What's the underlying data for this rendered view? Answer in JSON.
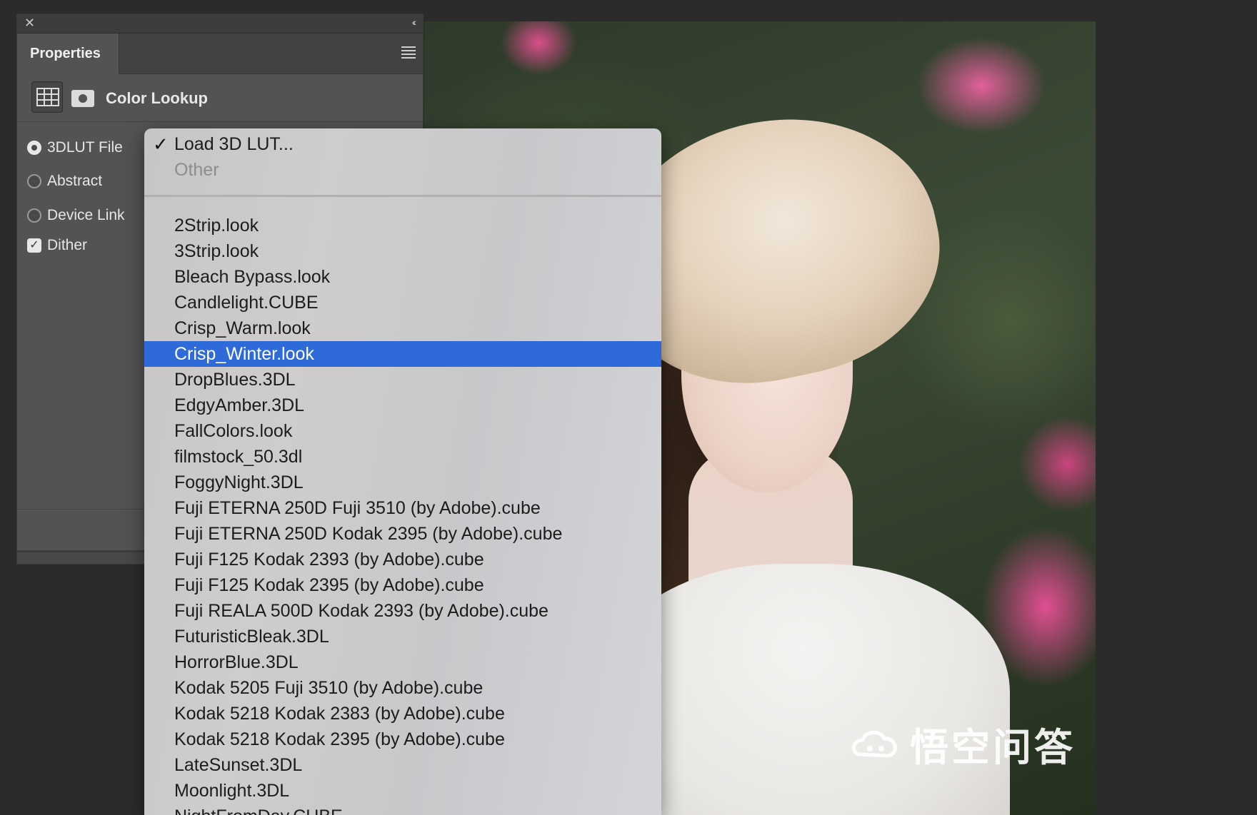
{
  "panel": {
    "tab_label": "Properties",
    "adjustment_title": "Color Lookup",
    "options": [
      {
        "label": "3DLUT File",
        "type": "radio",
        "checked": true
      },
      {
        "label": "Abstract",
        "type": "radio",
        "checked": false
      },
      {
        "label": "Device Link",
        "type": "radio",
        "checked": false
      },
      {
        "label": "Dither",
        "type": "checkbox",
        "checked": true
      }
    ]
  },
  "menu": {
    "header_items": [
      {
        "label": "Load 3D LUT...",
        "checked": true
      },
      {
        "label": "Other",
        "disabled": true
      }
    ],
    "selected_label": "Crisp_Winter.look",
    "items": [
      "2Strip.look",
      "3Strip.look",
      "Bleach Bypass.look",
      "Candlelight.CUBE",
      "Crisp_Warm.look",
      "Crisp_Winter.look",
      "DropBlues.3DL",
      "EdgyAmber.3DL",
      "FallColors.look",
      "filmstock_50.3dl",
      "FoggyNight.3DL",
      "Fuji ETERNA 250D Fuji 3510 (by Adobe).cube",
      "Fuji ETERNA 250D Kodak 2395 (by Adobe).cube",
      "Fuji F125 Kodak 2393 (by Adobe).cube",
      "Fuji F125 Kodak 2395 (by Adobe).cube",
      "Fuji REALA 500D Kodak 2393 (by Adobe).cube",
      "FuturisticBleak.3DL",
      "HorrorBlue.3DL",
      "Kodak 5205 Fuji 3510 (by Adobe).cube",
      "Kodak 5218 Kodak 2383 (by Adobe).cube",
      "Kodak 5218 Kodak 2395 (by Adobe).cube",
      "LateSunset.3DL",
      "Moonlight.3DL",
      "NightFromDay.CUBE"
    ],
    "selection_color": "#2f6bd8"
  },
  "watermark": {
    "text": "悟空问答"
  },
  "icons": {
    "close": "close-icon",
    "collapse": "double-chevron-left-icon",
    "panel_menu": "hamburger-menu-icon",
    "grid": "grid-table-icon",
    "mask": "layer-mask-icon",
    "check": "checkmark-icon"
  }
}
